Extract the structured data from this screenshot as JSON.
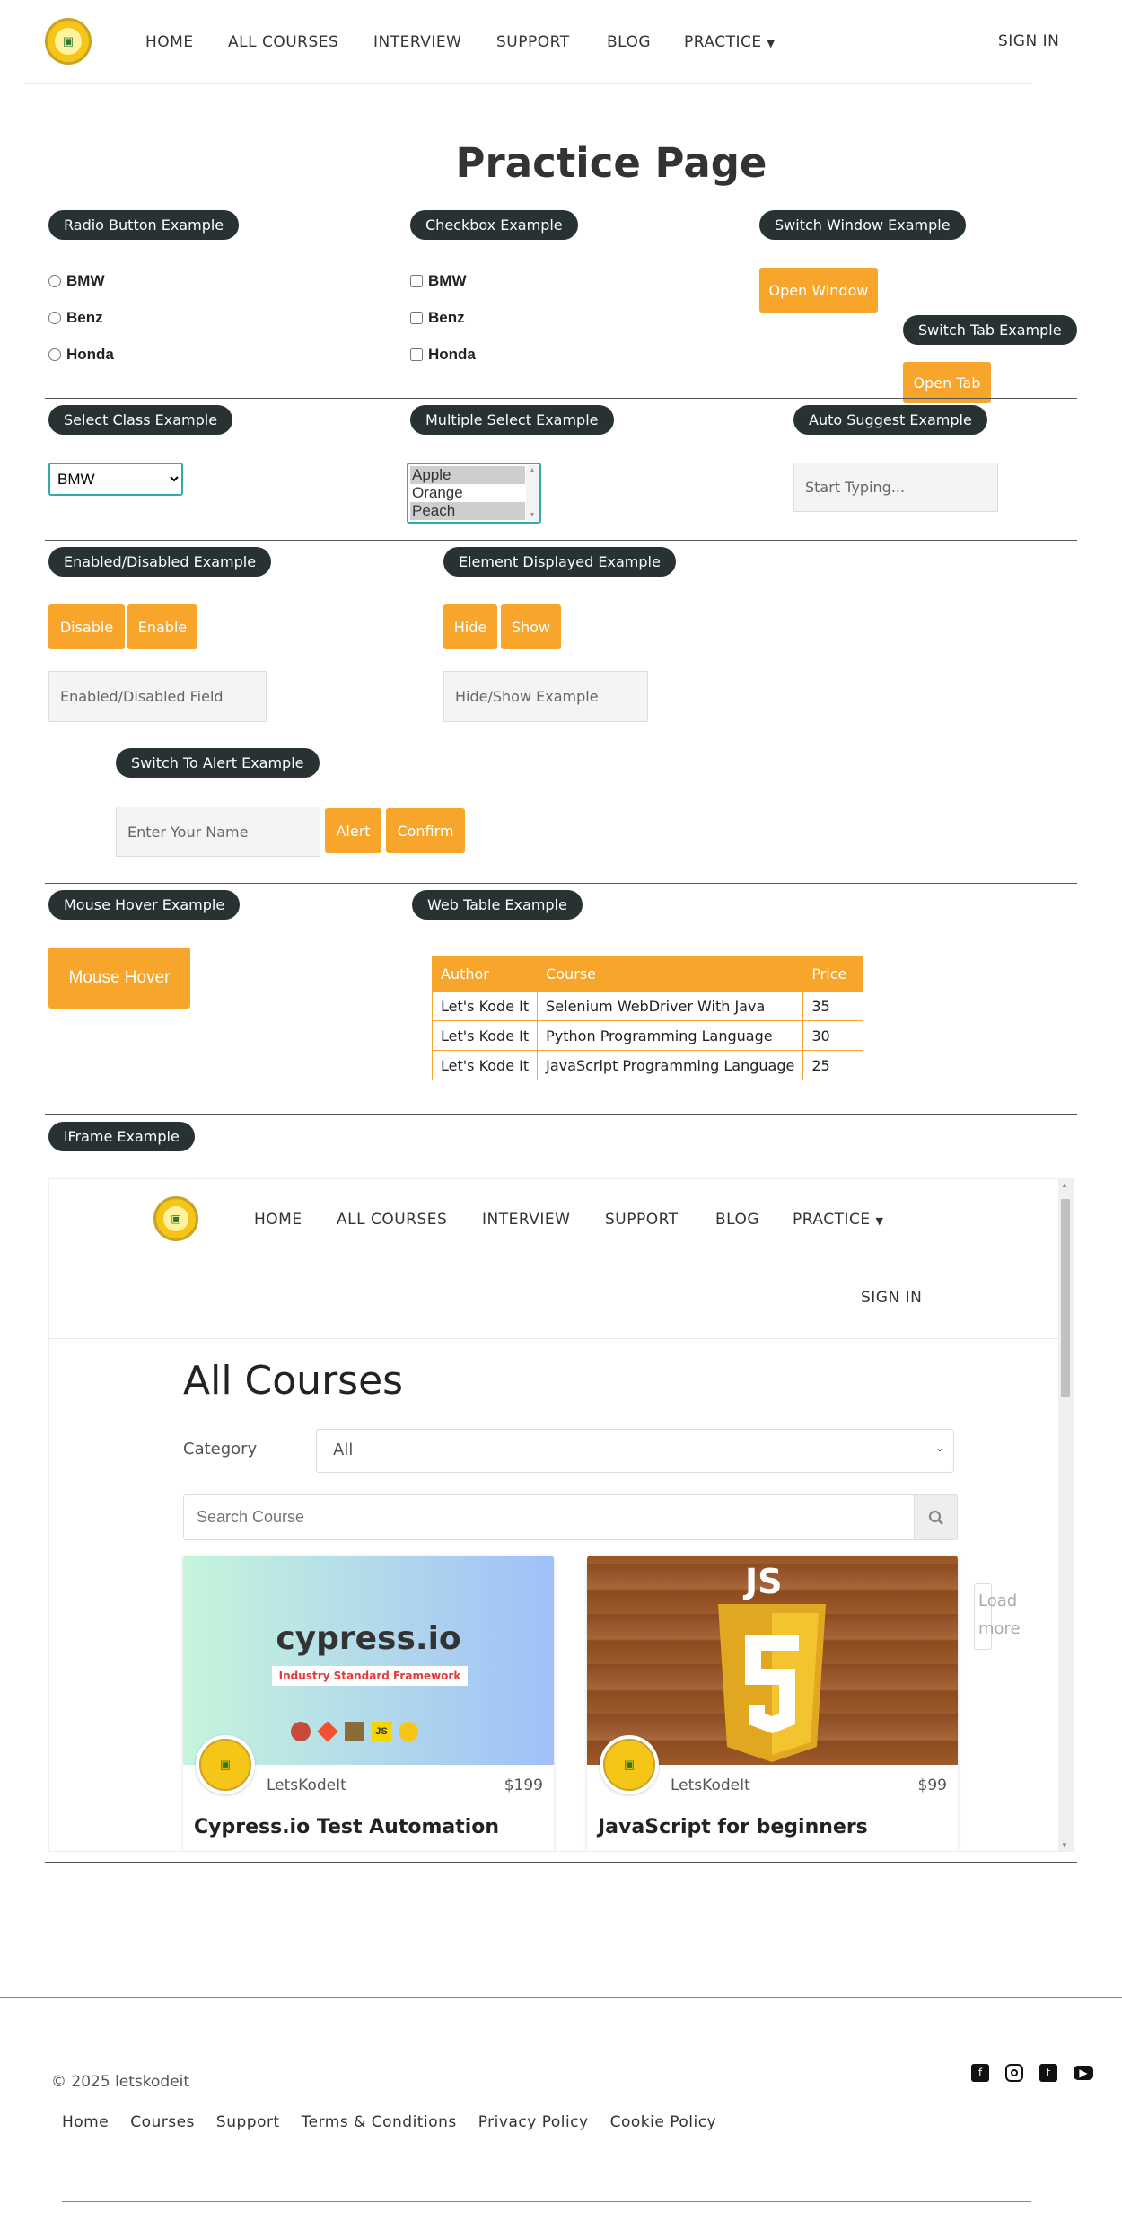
{
  "nav": {
    "items": [
      "HOME",
      "ALL COURSES",
      "INTERVIEW",
      "SUPPORT",
      "BLOG",
      "PRACTICE"
    ],
    "sign_in": "SIGN IN"
  },
  "page_title": "Practice Page",
  "radio": {
    "title": "Radio Button Example",
    "options": [
      "BMW",
      "Benz",
      "Honda"
    ]
  },
  "checkbox": {
    "title": "Checkbox Example",
    "options": [
      "BMW",
      "Benz",
      "Honda"
    ]
  },
  "switch_window": {
    "title": "Switch Window Example",
    "button": "Open Window"
  },
  "switch_tab": {
    "title": "Switch Tab Example",
    "button": "Open Tab"
  },
  "select_class": {
    "title": "Select Class Example",
    "selected": "BMW"
  },
  "multi_select": {
    "title": "Multiple Select Example",
    "options": [
      "Apple",
      "Orange",
      "Peach"
    ]
  },
  "auto_suggest": {
    "title": "Auto Suggest Example",
    "placeholder": "Start Typing..."
  },
  "enabled_disabled": {
    "title": "Enabled/Disabled Example",
    "disable": "Disable",
    "enable": "Enable",
    "placeholder": "Enabled/Disabled Field"
  },
  "element_displayed": {
    "title": "Element Displayed Example",
    "hide": "Hide",
    "show": "Show",
    "placeholder": "Hide/Show Example"
  },
  "alert": {
    "title": "Switch To Alert Example",
    "placeholder": "Enter Your Name",
    "alert": "Alert",
    "confirm": "Confirm"
  },
  "mouse_hover": {
    "title": "Mouse Hover Example",
    "button": "Mouse Hover"
  },
  "web_table": {
    "title": "Web Table Example",
    "headers": [
      "Author",
      "Course",
      "Price"
    ],
    "rows": [
      [
        "Let's Kode It",
        "Selenium WebDriver With Java",
        "35"
      ],
      [
        "Let's Kode It",
        "Python Programming Language",
        "30"
      ],
      [
        "Let's Kode It",
        "JavaScript Programming Language",
        "25"
      ]
    ]
  },
  "iframe": {
    "title": "iFrame Example",
    "nav_items": [
      "HOME",
      "ALL COURSES",
      "INTERVIEW",
      "SUPPORT",
      "BLOG",
      "PRACTICE"
    ],
    "sign_in": "SIGN IN",
    "heading": "All Courses",
    "category_label": "Category",
    "category_selected": "All",
    "search_placeholder": "Search Course",
    "load_more": "Load more",
    "cards": [
      {
        "banner_title": "cypress.io",
        "banner_tagline": "Industry Standard Framework",
        "author": "LetsKodeIt",
        "price": "$199",
        "title": "Cypress.io Test Automation"
      },
      {
        "banner_title": "JS",
        "author": "LetsKodeIt",
        "price": "$99",
        "title": "JavaScript for beginners"
      }
    ]
  },
  "footer": {
    "copyright": "© 2025 letskodeit",
    "links": [
      "Home",
      "Courses",
      "Support",
      "Terms & Conditions",
      "Privacy Policy",
      "Cookie Policy"
    ]
  },
  "colors": {
    "accent": "#f7a52b",
    "pill": "#283232"
  },
  "icons": [
    "facebook-icon",
    "instagram-icon",
    "twitter-icon",
    "youtube-icon",
    "search-icon",
    "caret-down-icon"
  ]
}
